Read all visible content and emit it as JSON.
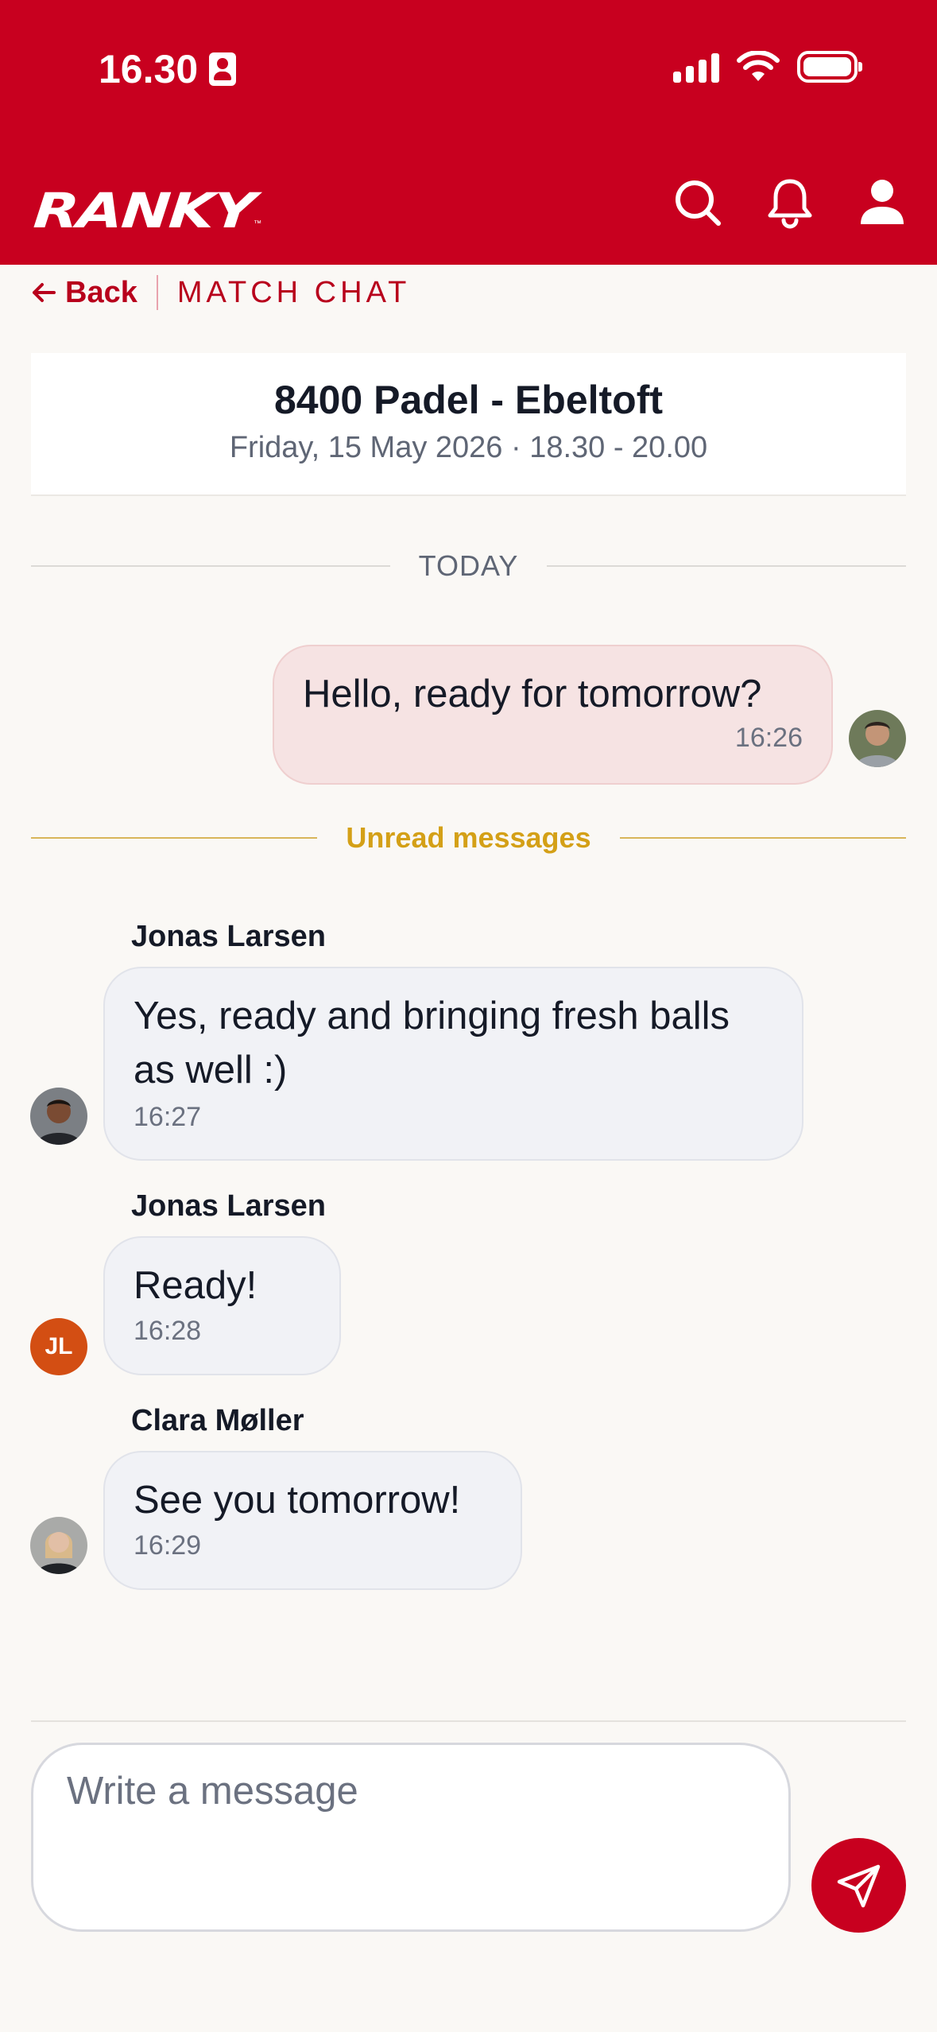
{
  "status_bar": {
    "time": "16.30"
  },
  "header": {
    "logo": "RANKY",
    "logo_tm": "™",
    "icons": [
      "search-icon",
      "bell-icon",
      "user-icon"
    ]
  },
  "subnav": {
    "back_label": "Back",
    "title": "MATCH CHAT"
  },
  "match": {
    "title": "8400 Padel - Ebeltoft",
    "subtitle": "Friday, 15 May 2026 · 18.30 - 20.00"
  },
  "dividers": {
    "today": "TODAY",
    "unread": "Unread messages"
  },
  "messages": [
    {
      "own": true,
      "text": "Hello, ready for tomorrow?",
      "time": "16:26"
    },
    {
      "sender": "Jonas Larsen",
      "text": "Yes, ready and bringing fresh balls as well :)",
      "time": "16:27"
    },
    {
      "sender": "Jonas Larsen",
      "initials": "JL",
      "text": "Ready!",
      "time": "16:28"
    },
    {
      "sender": "Clara Møller",
      "text": "See you tomorrow!",
      "time": "16:29"
    }
  ],
  "composer": {
    "placeholder": "Write a message"
  },
  "colors": {
    "brand": "#c8001f",
    "own_bubble": "#f6e3e3",
    "other_bubble": "#f1f2f6",
    "unread_accent": "#d4a017",
    "initials_avatar": "#d34e13"
  }
}
